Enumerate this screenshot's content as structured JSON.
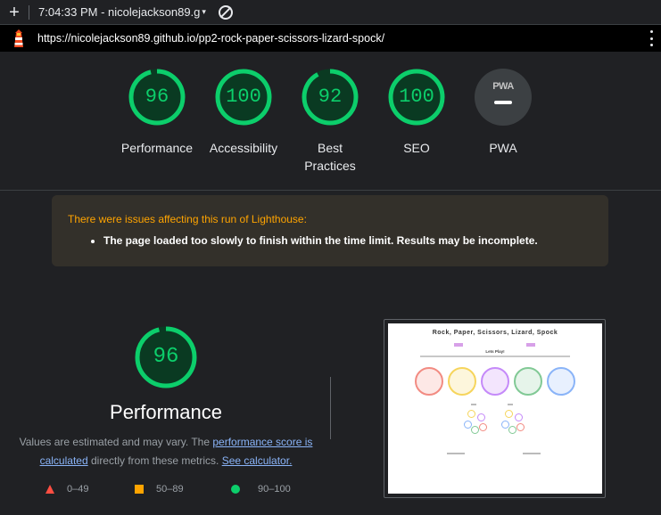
{
  "topbar": {
    "new_tab": "+",
    "session": "7:04:33 PM - nicolejackson89.g",
    "caret": "▾"
  },
  "urlbar": {
    "url": "https://nicolejackson89.github.io/pp2-rock-paper-scissors-lizard-spock/"
  },
  "scores": [
    {
      "label": "Performance",
      "value": "96",
      "fraction": 0.96
    },
    {
      "label": "Accessibility",
      "value": "100",
      "fraction": 1.0
    },
    {
      "label": "Best Practices",
      "value": "92",
      "fraction": 0.92
    },
    {
      "label": "SEO",
      "value": "100",
      "fraction": 1.0
    },
    {
      "label": "PWA",
      "badge": "PWA"
    }
  ],
  "warning": {
    "title": "There were issues affecting this run of Lighthouse:",
    "item": "The page loaded too slowly to finish within the time limit. Results may be incomplete."
  },
  "performance": {
    "score": "96",
    "fraction": 0.96,
    "title": "Performance",
    "desc_1": "Values are estimated and may vary. The ",
    "link_1": "performance score is calculated",
    "desc_2": " directly from these metrics. ",
    "link_2": "See calculator."
  },
  "legend": [
    {
      "range": "0–49",
      "color": "#ff4e42"
    },
    {
      "range": "50–89",
      "color": "#ffa400"
    },
    {
      "range": "90–100",
      "color": "#0cce6b"
    }
  ],
  "screenshot": {
    "title": "Rock, Paper, Scissors, Lizard, Spock",
    "subtitle": "Lets Play!"
  },
  "colors": {
    "pass": "#0cce6b",
    "pass_track": "#0a3a22",
    "warn": "#ffa400",
    "fail": "#ff4e42",
    "bg": "#202124"
  }
}
